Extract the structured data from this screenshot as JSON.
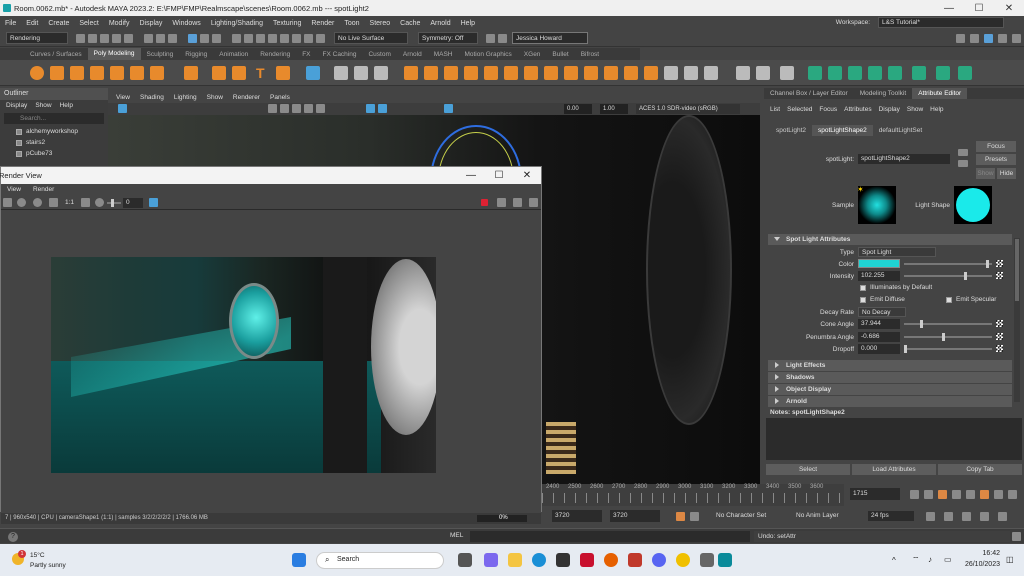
{
  "titlebar": {
    "title": "Room.0062.mb* - Autodesk MAYA 2023.2: E:\\FMP\\FMP\\Realmscape\\scenes\\Room.0062.mb  ---  spotLight2",
    "min": "—",
    "max": "☐",
    "close": "✕"
  },
  "menu": [
    "File",
    "Edit",
    "Create",
    "Select",
    "Modify",
    "Display",
    "Windows",
    "Lighting/Shading",
    "Texturing",
    "Render",
    "Toon",
    "Stereo",
    "Cache",
    "Arnold",
    "Help"
  ],
  "workspace": {
    "label": "Workspace:",
    "value": "L&S Tutorial*"
  },
  "statusline": {
    "mode": "Rendering",
    "live_surface": "No Live Surface",
    "symmetry": "Symmetry: Off",
    "user": "Jessica Howard"
  },
  "shelf_tabs": [
    "Curves / Surfaces",
    "Poly Modeling",
    "Sculpting",
    "Rigging",
    "Animation",
    "Rendering",
    "FX",
    "FX Caching",
    "Custom",
    "Arnold",
    "MASH",
    "Motion Graphics",
    "XGen",
    "Bullet",
    "Bifrost"
  ],
  "shelf_active": "Poly Modeling",
  "outliner": {
    "title": "Outliner",
    "menu": [
      "Display",
      "Show",
      "Help"
    ],
    "search_placeholder": "Search...",
    "items": [
      "alchemyworkshop",
      "stairs2",
      "pCube73"
    ]
  },
  "viewport": {
    "menu": [
      "View",
      "Shading",
      "Lighting",
      "Show",
      "Renderer",
      "Panels"
    ],
    "val1": "0.00",
    "val2": "1.00",
    "colorspace": "ACES 1.0 SDR-video (sRGB)"
  },
  "renderview": {
    "title": "Render View",
    "menu": [
      "View",
      "Render"
    ],
    "ratio": "1:1",
    "exposure": "0",
    "status": "7 | 960x540 | CPU | cameraShape1 (1:1) | samples 3/2/2/2/2/2 | 1766.06 MB",
    "progress_label": "0%",
    "progress": 0.0,
    "min": "—",
    "max": "☐",
    "close": "✕"
  },
  "attr_editor": {
    "tabs": [
      "Channel Box / Layer Editor",
      "Modeling Toolkit",
      "Attribute Editor"
    ],
    "tab_active": "Attribute Editor",
    "menu": [
      "List",
      "Selected",
      "Focus",
      "Attributes",
      "Display",
      "Show",
      "Help"
    ],
    "nodes": [
      "spotLight2",
      "spotLightShape2",
      "defaultLightSet"
    ],
    "node_active": "spotLightShape2",
    "node_label": "spotLight:",
    "node_value": "spotLightShape2",
    "focus": "Focus",
    "presets": "Presets",
    "show": "Show",
    "hide": "Hide",
    "sample_label": "Sample",
    "light_shape_label": "Light Shape",
    "section_spot": "Spot Light Attributes",
    "type_label": "Type",
    "type_value": "Spot Light",
    "color_label": "Color",
    "light_color": "#1fd3d3",
    "intensity_label": "Intensity",
    "intensity": "102.255",
    "illum_default": "Illuminates by Default",
    "emit_diffuse": "Emit Diffuse",
    "emit_specular": "Emit Specular",
    "decay_label": "Decay Rate",
    "decay_value": "No Decay",
    "cone_label": "Cone Angle",
    "cone": "37.944",
    "penumbra_label": "Penumbra Angle",
    "penumbra": "-0.686",
    "dropoff_label": "Dropoff",
    "dropoff": "0.000",
    "sections": [
      "Light Effects",
      "Shadows",
      "Object Display",
      "Arnold"
    ],
    "notes": "Notes: spotLightShape2",
    "select": "Select",
    "load": "Load Attributes",
    "copy": "Copy Tab"
  },
  "timeline": {
    "ticks": [
      "2400",
      "2500",
      "2600",
      "2700",
      "2800",
      "2900",
      "3000",
      "3100",
      "3200",
      "3300",
      "3400",
      "3500",
      "3600"
    ],
    "current": "1715"
  },
  "range": {
    "start": "3720",
    "end": "3720",
    "char_set": "No Character Set",
    "anim_layer": "No Anim Layer",
    "fps": "24 fps"
  },
  "cmdline": {
    "lang": "MEL",
    "result": "Undo: setAttr"
  },
  "taskbar": {
    "weather_temp": "15°C",
    "weather_desc": "Partly sunny",
    "search": "Search",
    "time": "16:42",
    "date": "26/10/2023",
    "badge": "1"
  }
}
